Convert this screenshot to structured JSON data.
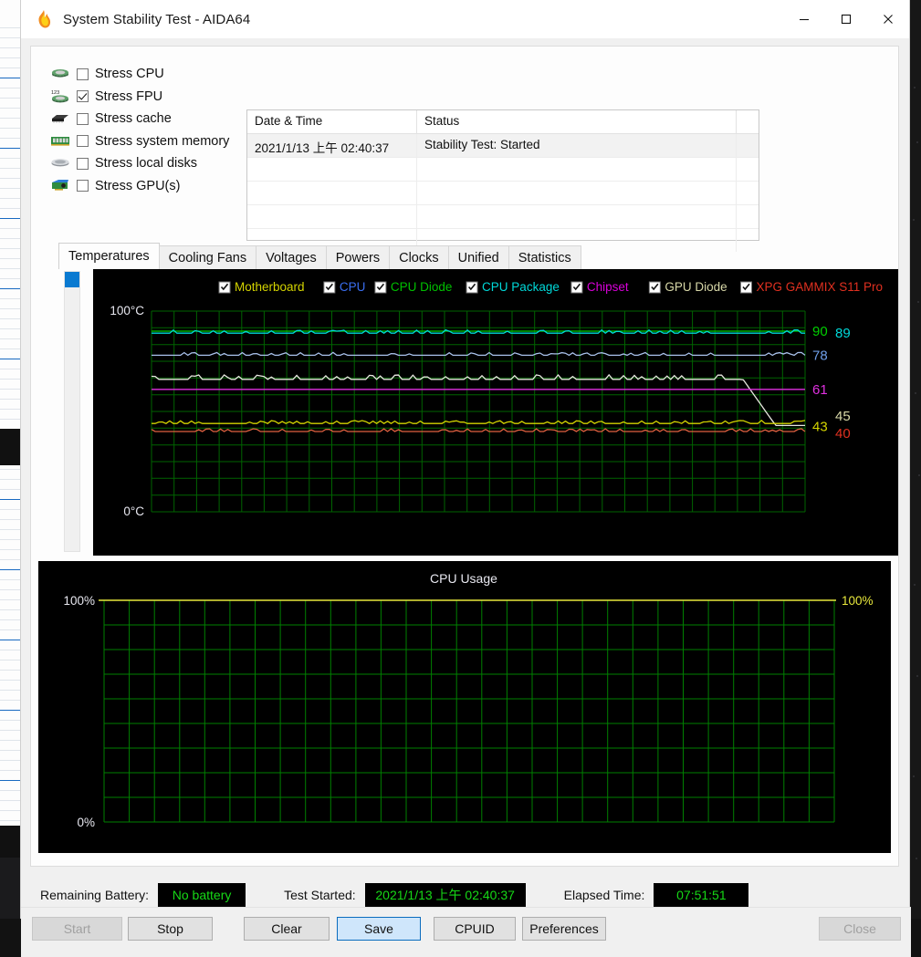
{
  "window": {
    "title": "System Stability Test - AIDA64",
    "icon": "flame-icon",
    "controls": {
      "minimize": "—",
      "maximize": "☐",
      "close": "✕"
    }
  },
  "stress": {
    "items": [
      {
        "label": "Stress CPU",
        "checked": false,
        "icon": "cpu-chip-icon"
      },
      {
        "label": "Stress FPU",
        "checked": true,
        "icon": "fpu-chip-icon"
      },
      {
        "label": "Stress cache",
        "checked": false,
        "icon": "cache-chip-icon"
      },
      {
        "label": "Stress system memory",
        "checked": false,
        "icon": "memory-module-icon"
      },
      {
        "label": "Stress local disks",
        "checked": false,
        "icon": "hard-disk-icon"
      },
      {
        "label": "Stress GPU(s)",
        "checked": false,
        "icon": "gpu-card-icon"
      }
    ]
  },
  "log": {
    "columns": [
      "Date & Time",
      "Status",
      ""
    ],
    "rows": [
      {
        "datetime": "2021/1/13 上午 02:40:37",
        "status": "Stability Test: Started",
        "selected": true
      },
      {
        "datetime": "",
        "status": "",
        "selected": false
      },
      {
        "datetime": "",
        "status": "",
        "selected": false
      },
      {
        "datetime": "",
        "status": "",
        "selected": false
      },
      {
        "datetime": "",
        "status": "",
        "selected": false
      }
    ]
  },
  "tabs": {
    "active": "Temperatures",
    "items": [
      "Temperatures",
      "Cooling Fans",
      "Voltages",
      "Powers",
      "Clocks",
      "Unified",
      "Statistics"
    ]
  },
  "temp_legend": [
    {
      "label": "Motherboard",
      "color": "#d4d400",
      "checked": true
    },
    {
      "label": "CPU",
      "color": "#3a6ef0",
      "checked": true
    },
    {
      "label": "CPU Diode",
      "color": "#00c000",
      "checked": true
    },
    {
      "label": "CPU Package",
      "color": "#00d8d8",
      "checked": true
    },
    {
      "label": "Chipset",
      "color": "#d800d8",
      "checked": true
    },
    {
      "label": "GPU Diode",
      "color": "#d8d8a8",
      "checked": true
    },
    {
      "label": "XPG GAMMIX S11 Pro",
      "color": "#e03020",
      "checked": true
    }
  ],
  "chart_data": [
    {
      "type": "line",
      "name": "temperatures-graph",
      "title": "",
      "ylabel_top": "100°C",
      "ylabel_bottom": "0°C",
      "ylim": [
        0,
        100
      ],
      "grid": true,
      "background": "#000000",
      "grid_color": "#006400",
      "current_value_labels": [
        {
          "text": "90",
          "color": "#00d000",
          "value": 90
        },
        {
          "text": "89",
          "color": "#00d8d8",
          "value": 89
        },
        {
          "text": "78",
          "color": "#6e9ee8",
          "value": 78
        },
        {
          "text": "61",
          "color": "#e030e0",
          "value": 61
        },
        {
          "text": "43",
          "color": "#d4d400",
          "value": 43
        },
        {
          "text": "45",
          "color": "#d8d8a8",
          "value": 45
        },
        {
          "text": "40",
          "color": "#e03020",
          "value": 40
        }
      ],
      "series": [
        {
          "name": "CPU Diode",
          "color": "#00d000",
          "value": 90,
          "baseline": 90,
          "noise": 0.0
        },
        {
          "name": "CPU Package",
          "color": "#00d8d8",
          "value": 89,
          "baseline": 89,
          "noise": 1.2
        },
        {
          "name": "CPU",
          "color": "#a8c0ea",
          "value": 78,
          "baseline": 78,
          "noise": 1.0
        },
        {
          "name": "GPU Diode",
          "color": "#e8e8e0",
          "value": 45,
          "baseline": 66,
          "noise": 1.6,
          "dropoff": 43
        },
        {
          "name": "Chipset",
          "color": "#e030e0",
          "value": 61,
          "baseline": 61,
          "noise": 0.0
        },
        {
          "name": "Motherboard",
          "color": "#d4d400",
          "value": 43,
          "baseline": 44,
          "noise": 1.1
        },
        {
          "name": "XPG GAMMIX S11 Pro",
          "color": "#e06040",
          "value": 40,
          "baseline": 40,
          "noise": 1.0
        }
      ]
    },
    {
      "type": "line",
      "name": "cpu-usage-graph",
      "title": "CPU Usage",
      "ylabel_left_top": "100%",
      "ylabel_left_bottom": "0%",
      "ylabel_right_top": "100%",
      "ylim": [
        0,
        100
      ],
      "grid": true,
      "background": "#000000",
      "grid_color": "#008000",
      "series": [
        {
          "name": "CPU Usage",
          "color": "#e8e83c",
          "value": 100,
          "baseline": 100,
          "noise": 0.0
        }
      ]
    }
  ],
  "status": {
    "battery_label": "Remaining Battery:",
    "battery_value": "No battery",
    "started_label": "Test Started:",
    "started_value": "2021/1/13 上午 02:40:37",
    "elapsed_label": "Elapsed Time:",
    "elapsed_value": "07:51:51",
    "value_color": "#16d916"
  },
  "buttons": [
    {
      "label": "Start",
      "state": "disabled"
    },
    {
      "label": "Stop",
      "state": "normal"
    },
    {
      "label": "Clear",
      "state": "normal"
    },
    {
      "label": "Save",
      "state": "default"
    },
    {
      "label": "CPUID",
      "state": "normal"
    },
    {
      "label": "Preferences",
      "state": "normal"
    },
    {
      "label": "Close",
      "state": "disabled"
    }
  ]
}
